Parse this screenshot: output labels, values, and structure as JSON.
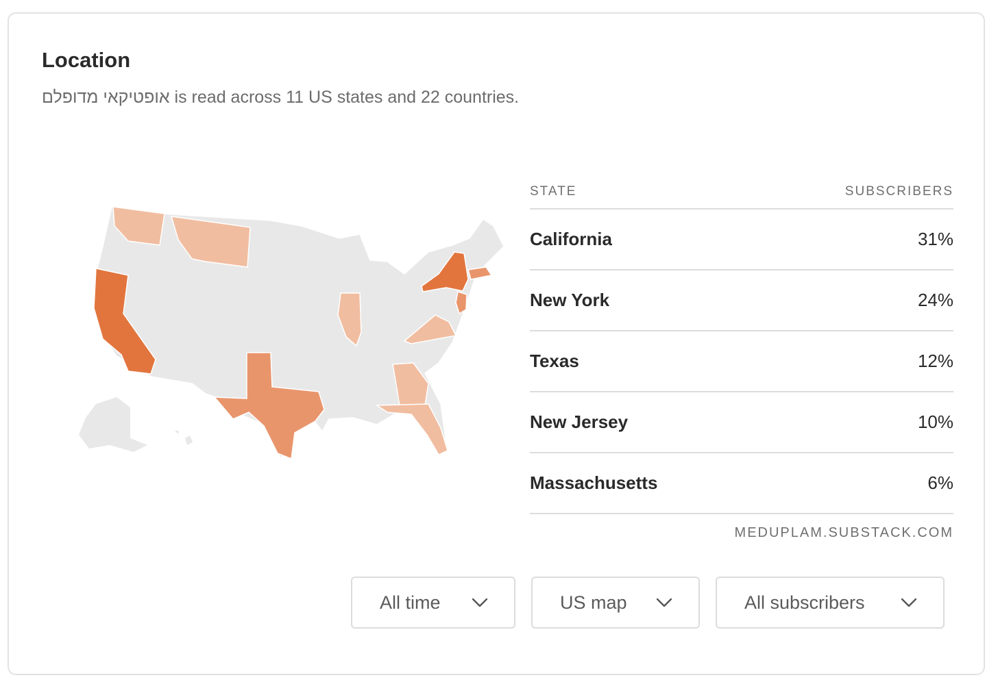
{
  "header": {
    "title": "Location",
    "subtitle": "אופטיקאי מדופלם is read across 11 US states and 22 countries."
  },
  "table": {
    "col_state": "STATE",
    "col_subscribers": "SUBSCRIBERS",
    "rows": [
      {
        "state": "California",
        "pct": "31%"
      },
      {
        "state": "New York",
        "pct": "24%"
      },
      {
        "state": "Texas",
        "pct": "12%"
      },
      {
        "state": "New Jersey",
        "pct": "10%"
      },
      {
        "state": "Massachusetts",
        "pct": "6%"
      }
    ],
    "source": "MEDUPLAM.SUBSTACK.COM"
  },
  "filters": {
    "time": "All time",
    "view": "US map",
    "audience": "All subscribers",
    "icon": "chevron-down-icon"
  },
  "colors": {
    "strong": "#e2753e",
    "medium": "#e9956c",
    "light": "#f1bda0",
    "base": "#e8e8e8",
    "border": "#ffffff"
  }
}
